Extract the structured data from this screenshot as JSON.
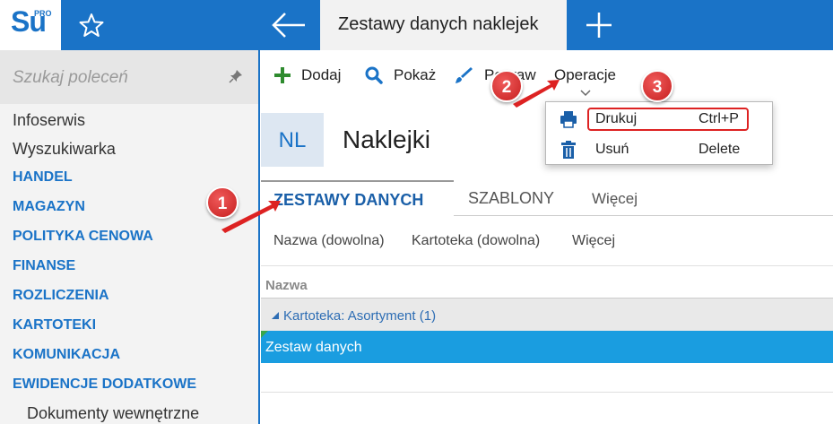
{
  "app": {
    "logo_text": "Su",
    "logo_pro": "PRO"
  },
  "header": {
    "active_tab": "Zestawy danych naklejek"
  },
  "sidebar": {
    "search_placeholder": "Szukaj poleceń",
    "items": [
      {
        "label": "Infoserwis",
        "style": "normal"
      },
      {
        "label": "Wyszukiwarka",
        "style": "normal"
      },
      {
        "label": "HANDEL",
        "style": "bold"
      },
      {
        "label": "MAGAZYN",
        "style": "bold"
      },
      {
        "label": "POLITYKA CENOWA",
        "style": "bold"
      },
      {
        "label": "FINANSE",
        "style": "bold"
      },
      {
        "label": "ROZLICZENIA",
        "style": "bold"
      },
      {
        "label": "KARTOTEKI",
        "style": "bold"
      },
      {
        "label": "KOMUNIKACJA",
        "style": "bold"
      },
      {
        "label": "EWIDENCJE DODATKOWE",
        "style": "bold"
      },
      {
        "label": "Dokumenty wewnętrzne",
        "style": "sub"
      }
    ]
  },
  "toolbar": {
    "add_label": "Dodaj",
    "show_label": "Pokaż",
    "edit_label": "Popraw",
    "operations_label": "Operacje"
  },
  "page": {
    "badge": "NL",
    "title": "Naklejki"
  },
  "tabs": [
    {
      "label": "ZESTAWY DANYCH"
    },
    {
      "label": "SZABLONY"
    },
    {
      "label": "Więcej"
    }
  ],
  "filters": [
    "Nazwa (dowolna)",
    "Kartoteka (dowolna)",
    "Więcej"
  ],
  "table": {
    "column_header": "Nazwa",
    "group_label": "Kartoteka: Asortyment (1)",
    "rows": [
      "Zestaw danych"
    ]
  },
  "dropdown": {
    "items": [
      {
        "label": "Drukuj",
        "shortcut": "Ctrl+P",
        "icon": "printer-icon"
      },
      {
        "label": "Usuń",
        "shortcut": "Delete",
        "icon": "trash-icon"
      }
    ]
  },
  "callouts": [
    "1",
    "2",
    "3"
  ],
  "colors": {
    "brand": "#1a73c7",
    "selection": "#1a9de0",
    "callout": "#d22"
  }
}
